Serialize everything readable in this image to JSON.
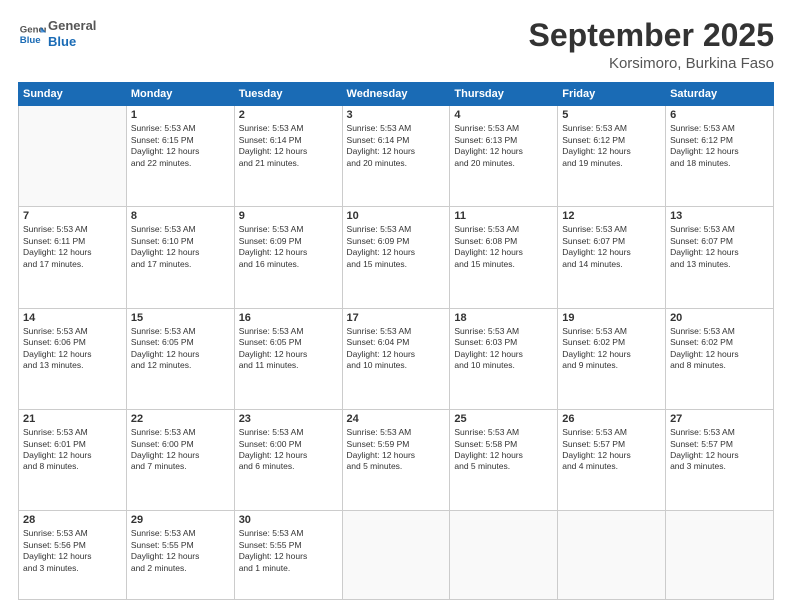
{
  "header": {
    "logo_line1": "General",
    "logo_line2": "Blue",
    "title": "September 2025",
    "subtitle": "Korsimoro, Burkina Faso"
  },
  "days_of_week": [
    "Sunday",
    "Monday",
    "Tuesday",
    "Wednesday",
    "Thursday",
    "Friday",
    "Saturday"
  ],
  "weeks": [
    [
      {
        "day": "",
        "text": ""
      },
      {
        "day": "1",
        "text": "Sunrise: 5:53 AM\nSunset: 6:15 PM\nDaylight: 12 hours\nand 22 minutes."
      },
      {
        "day": "2",
        "text": "Sunrise: 5:53 AM\nSunset: 6:14 PM\nDaylight: 12 hours\nand 21 minutes."
      },
      {
        "day": "3",
        "text": "Sunrise: 5:53 AM\nSunset: 6:14 PM\nDaylight: 12 hours\nand 20 minutes."
      },
      {
        "day": "4",
        "text": "Sunrise: 5:53 AM\nSunset: 6:13 PM\nDaylight: 12 hours\nand 20 minutes."
      },
      {
        "day": "5",
        "text": "Sunrise: 5:53 AM\nSunset: 6:12 PM\nDaylight: 12 hours\nand 19 minutes."
      },
      {
        "day": "6",
        "text": "Sunrise: 5:53 AM\nSunset: 6:12 PM\nDaylight: 12 hours\nand 18 minutes."
      }
    ],
    [
      {
        "day": "7",
        "text": "Sunrise: 5:53 AM\nSunset: 6:11 PM\nDaylight: 12 hours\nand 17 minutes."
      },
      {
        "day": "8",
        "text": "Sunrise: 5:53 AM\nSunset: 6:10 PM\nDaylight: 12 hours\nand 17 minutes."
      },
      {
        "day": "9",
        "text": "Sunrise: 5:53 AM\nSunset: 6:09 PM\nDaylight: 12 hours\nand 16 minutes."
      },
      {
        "day": "10",
        "text": "Sunrise: 5:53 AM\nSunset: 6:09 PM\nDaylight: 12 hours\nand 15 minutes."
      },
      {
        "day": "11",
        "text": "Sunrise: 5:53 AM\nSunset: 6:08 PM\nDaylight: 12 hours\nand 15 minutes."
      },
      {
        "day": "12",
        "text": "Sunrise: 5:53 AM\nSunset: 6:07 PM\nDaylight: 12 hours\nand 14 minutes."
      },
      {
        "day": "13",
        "text": "Sunrise: 5:53 AM\nSunset: 6:07 PM\nDaylight: 12 hours\nand 13 minutes."
      }
    ],
    [
      {
        "day": "14",
        "text": "Sunrise: 5:53 AM\nSunset: 6:06 PM\nDaylight: 12 hours\nand 13 minutes."
      },
      {
        "day": "15",
        "text": "Sunrise: 5:53 AM\nSunset: 6:05 PM\nDaylight: 12 hours\nand 12 minutes."
      },
      {
        "day": "16",
        "text": "Sunrise: 5:53 AM\nSunset: 6:05 PM\nDaylight: 12 hours\nand 11 minutes."
      },
      {
        "day": "17",
        "text": "Sunrise: 5:53 AM\nSunset: 6:04 PM\nDaylight: 12 hours\nand 10 minutes."
      },
      {
        "day": "18",
        "text": "Sunrise: 5:53 AM\nSunset: 6:03 PM\nDaylight: 12 hours\nand 10 minutes."
      },
      {
        "day": "19",
        "text": "Sunrise: 5:53 AM\nSunset: 6:02 PM\nDaylight: 12 hours\nand 9 minutes."
      },
      {
        "day": "20",
        "text": "Sunrise: 5:53 AM\nSunset: 6:02 PM\nDaylight: 12 hours\nand 8 minutes."
      }
    ],
    [
      {
        "day": "21",
        "text": "Sunrise: 5:53 AM\nSunset: 6:01 PM\nDaylight: 12 hours\nand 8 minutes."
      },
      {
        "day": "22",
        "text": "Sunrise: 5:53 AM\nSunset: 6:00 PM\nDaylight: 12 hours\nand 7 minutes."
      },
      {
        "day": "23",
        "text": "Sunrise: 5:53 AM\nSunset: 6:00 PM\nDaylight: 12 hours\nand 6 minutes."
      },
      {
        "day": "24",
        "text": "Sunrise: 5:53 AM\nSunset: 5:59 PM\nDaylight: 12 hours\nand 5 minutes."
      },
      {
        "day": "25",
        "text": "Sunrise: 5:53 AM\nSunset: 5:58 PM\nDaylight: 12 hours\nand 5 minutes."
      },
      {
        "day": "26",
        "text": "Sunrise: 5:53 AM\nSunset: 5:57 PM\nDaylight: 12 hours\nand 4 minutes."
      },
      {
        "day": "27",
        "text": "Sunrise: 5:53 AM\nSunset: 5:57 PM\nDaylight: 12 hours\nand 3 minutes."
      }
    ],
    [
      {
        "day": "28",
        "text": "Sunrise: 5:53 AM\nSunset: 5:56 PM\nDaylight: 12 hours\nand 3 minutes."
      },
      {
        "day": "29",
        "text": "Sunrise: 5:53 AM\nSunset: 5:55 PM\nDaylight: 12 hours\nand 2 minutes."
      },
      {
        "day": "30",
        "text": "Sunrise: 5:53 AM\nSunset: 5:55 PM\nDaylight: 12 hours\nand 1 minute."
      },
      {
        "day": "",
        "text": ""
      },
      {
        "day": "",
        "text": ""
      },
      {
        "day": "",
        "text": ""
      },
      {
        "day": "",
        "text": ""
      }
    ]
  ]
}
